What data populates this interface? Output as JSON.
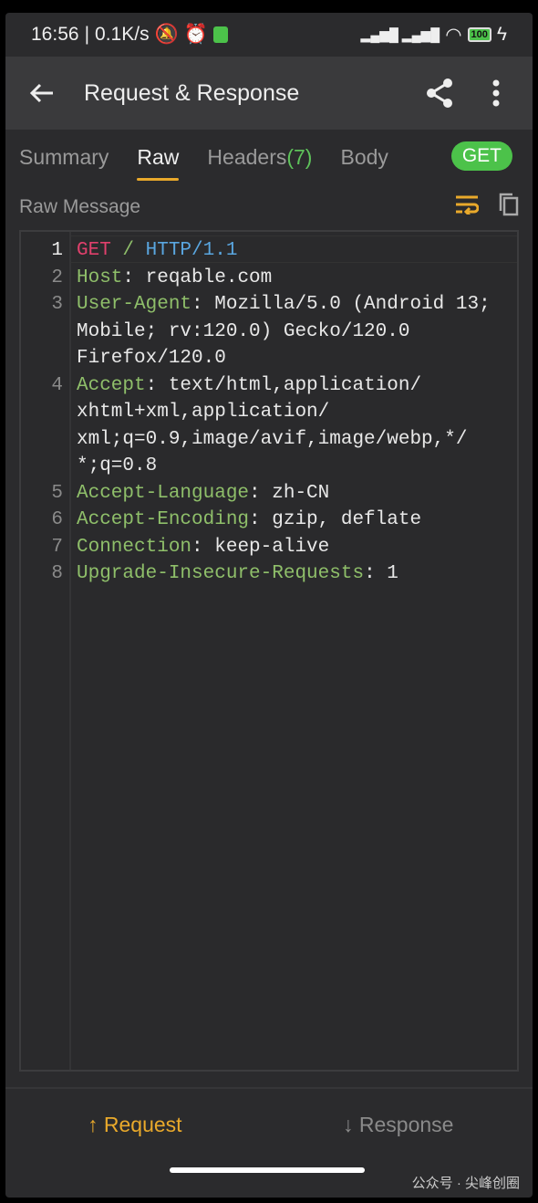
{
  "status": {
    "time": "16:56",
    "speed": "0.1K/s",
    "battery": "100"
  },
  "appbar": {
    "title": "Request & Response",
    "back_icon": "arrow-left-icon",
    "share_icon": "share-icon",
    "more_icon": "more-vertical-icon"
  },
  "tabs": [
    {
      "label": "Summary"
    },
    {
      "label": "Raw",
      "active": true
    },
    {
      "label": "Headers",
      "count": "(7)"
    },
    {
      "label": "Body"
    }
  ],
  "method_badge": "GET",
  "method_badge_color": "#4cc24a",
  "raw": {
    "label": "Raw Message",
    "wrap_icon": "wrap-text-icon",
    "copy_icon": "copy-icon",
    "accent": "#e9a92b"
  },
  "request_line": {
    "num": "1",
    "method": "GET",
    "slash": " / ",
    "proto": "HTTP/1.1"
  },
  "headers": [
    {
      "num": "2",
      "key": "Host",
      "value": [
        ": reqable.com"
      ]
    },
    {
      "num": "3",
      "key": "User-Agent",
      "value": [
        ": Mozilla/5.0 (Android 13;",
        "Mobile; rv:120.0) Gecko/120.0",
        "Firefox/120.0"
      ]
    },
    {
      "num": "4",
      "key": "Accept",
      "value": [
        ": text/html,application/",
        "xhtml+xml,application/",
        "xml;q=0.9,image/avif,image/webp,*/",
        "*;q=0.8"
      ]
    },
    {
      "num": "5",
      "key": "Accept-Language",
      "value": [
        ": zh-CN"
      ]
    },
    {
      "num": "6",
      "key": "Accept-Encoding",
      "value": [
        ": gzip, deflate"
      ]
    },
    {
      "num": "7",
      "key": "Connection",
      "value": [
        ": keep-alive"
      ]
    },
    {
      "num": "8",
      "key": "Upgrade-Insecure-Requests",
      "value": [
        ": 1"
      ]
    }
  ],
  "bottom": {
    "request": "↑ Request",
    "response": "↓ Response"
  },
  "watermark": "公众号 · 尖峰创圈"
}
